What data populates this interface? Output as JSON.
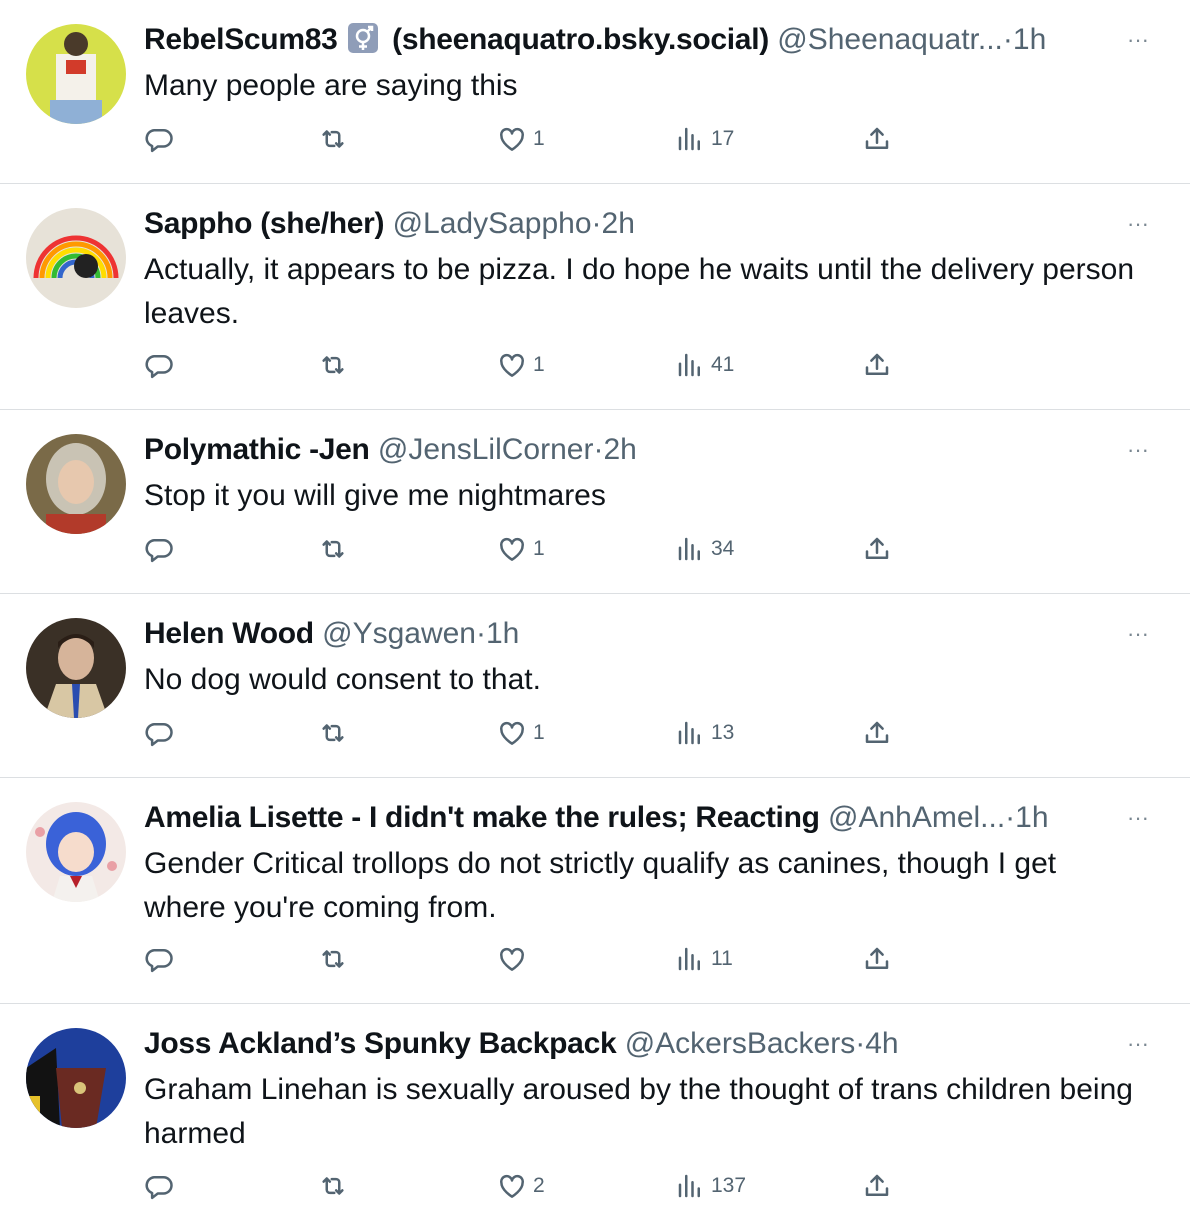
{
  "tweets": [
    {
      "name": "RebelScum83",
      "badge": "transgender-symbol",
      "display_extra": "(sheenaquatro.bsky.social)",
      "handle": "@Sheenaquatr...",
      "sep": "·",
      "time": "1h",
      "text": "Many people are saying this",
      "likes": "1",
      "views": "17",
      "avatar_color": "#d6e04a"
    },
    {
      "name": "Sappho (she/her)",
      "display_extra": "",
      "handle": "@LadySappho",
      "sep": "·",
      "time": "2h",
      "text": "Actually, it appears to be pizza. I do hope he waits until the delivery person leaves.",
      "likes": "1",
      "views": "41",
      "avatar_color": "#e7e2d8"
    },
    {
      "name": "Polymathic -Jen",
      "display_extra": "",
      "handle": "@JensLilCorner",
      "sep": "·",
      "time": "2h",
      "text": "Stop it you will give me nightmares",
      "likes": "1",
      "views": "34",
      "avatar_color": "#7a6a48"
    },
    {
      "name": "Helen Wood",
      "display_extra": "",
      "handle": "@Ysgawen",
      "sep": "·",
      "time": "1h",
      "text": "No dog would consent to that.",
      "likes": "1",
      "views": "13",
      "avatar_color": "#3a3026"
    },
    {
      "name": "Amelia Lisette - I didn't make the rules; Reacting",
      "display_extra": "",
      "handle": "@AnhAmel...",
      "sep": "·",
      "time": "1h",
      "text": "Gender Critical trollops do not strictly qualify as canines, though I get where you're coming from.",
      "likes": "",
      "views": "11",
      "avatar_color": "#f3e9e6"
    },
    {
      "name": "Joss Ackland’s Spunky Backpack",
      "display_extra": "",
      "handle": "@AckersBackers",
      "sep": "·",
      "time": "4h",
      "text": "Graham Linehan is sexually aroused by the thought of trans children being harmed",
      "likes": "2",
      "views": "137",
      "avatar_color": "#1e3f9c"
    }
  ],
  "more_label": "···",
  "icons": {
    "reply": "reply-icon",
    "retweet": "retweet-icon",
    "like": "like-icon",
    "views": "views-icon",
    "share": "share-icon",
    "more": "more-icon"
  },
  "colors": {
    "text": "#0f1419",
    "secondary": "#536471",
    "divider": "#dcdfe2"
  }
}
